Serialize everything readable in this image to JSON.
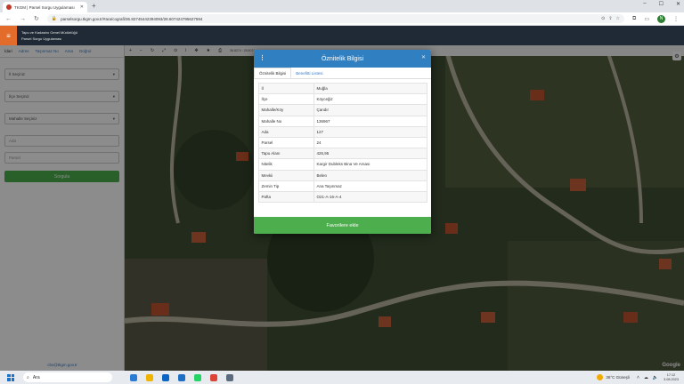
{
  "browser": {
    "tab_title": "TKGM | Parsel Sorgu Uygulaması",
    "url": "parselsorgu.tkgm.gov.tr/#ara/cografi/36.82745442394093/28.607424795627594",
    "profile_initial": "N"
  },
  "app": {
    "org": "Tapu ve Kadastro Genel Müdürlüğü",
    "name": "Parsel Sorgu Uygulaması"
  },
  "sidebar": {
    "tabs": [
      "İdari",
      "Adres",
      "Taşınmaz No",
      "Arsa",
      "Doğrul"
    ],
    "il": "İl Seçiniz",
    "ilce": "İlçe Seçiniz",
    "mahalle": "Mahalle Seçiniz",
    "ada_placeholder": "Ada",
    "parsel_placeholder": "Parsel",
    "query_button": "Sorgula",
    "email": "cbs@tkgm.gov.tr"
  },
  "map": {
    "coordinates": "36.8274 : 28.6074",
    "attribution": "Google"
  },
  "modal": {
    "title": "Öznitelik Bilgisi",
    "tabs": [
      "Öznitelik Bilgisi",
      "Benefitti Listesi"
    ],
    "rows": [
      {
        "key": "İl",
        "value": "Muğla"
      },
      {
        "key": "İlçe",
        "value": "Köyceğiz"
      },
      {
        "key": "Mahalle/Köy",
        "value": "Çandır"
      },
      {
        "key": "Mahalle No",
        "value": "136967"
      },
      {
        "key": "Ada",
        "value": "127"
      },
      {
        "key": "Parsel",
        "value": "24"
      },
      {
        "key": "Tapu Alanı",
        "value": "426,95"
      },
      {
        "key": "Nitelik",
        "value": "Kargir Dubleks Bina Ve Arsası"
      },
      {
        "key": "Mevkii",
        "value": "Belen"
      },
      {
        "key": "Zemin Tip",
        "value": "Ana Taşınmaz"
      },
      {
        "key": "Pafta",
        "value": "O21-A-16-A-4"
      }
    ],
    "favorite_button": "Favorilere ekle"
  },
  "taskbar": {
    "search_placeholder": "Ara",
    "weather": "36°C  Güneşli",
    "time": "17:12",
    "date": "3.08.2023"
  },
  "colors": {
    "header": "#2f7fc1",
    "accent_green": "#4cae4c",
    "menu_orange": "#e36c2a"
  }
}
